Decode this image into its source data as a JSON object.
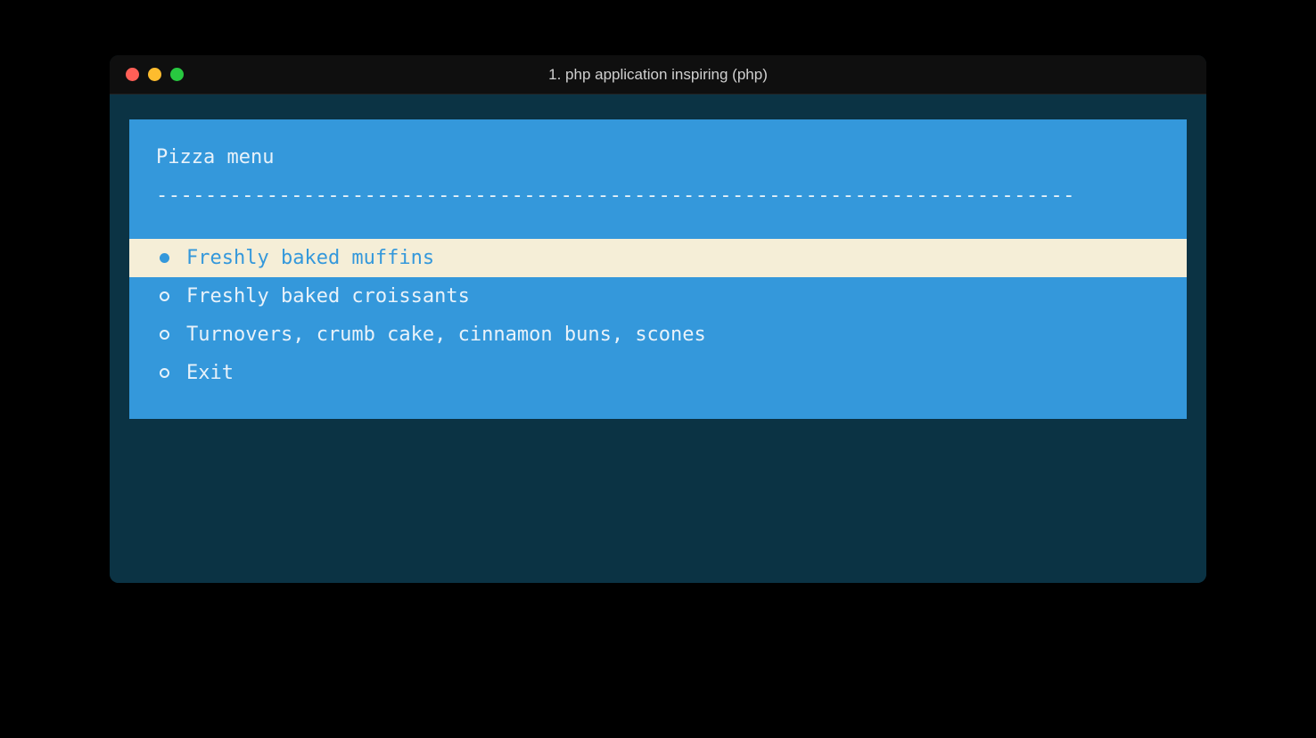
{
  "window": {
    "title": "1. php application inspiring (php)"
  },
  "menu": {
    "title": "Pizza menu",
    "divider": "---------------------------------------------------------------------------",
    "items": [
      {
        "label": "Freshly baked muffins",
        "selected": true
      },
      {
        "label": "Freshly baked croissants",
        "selected": false
      },
      {
        "label": "Turnovers, crumb cake, cinnamon buns, scones",
        "selected": false
      },
      {
        "label": "Exit",
        "selected": false
      }
    ]
  },
  "colors": {
    "terminal_bg": "#0b3344",
    "panel_bg": "#3498db",
    "highlight_bg": "#f5eed7",
    "text": "#e8f2fa"
  }
}
